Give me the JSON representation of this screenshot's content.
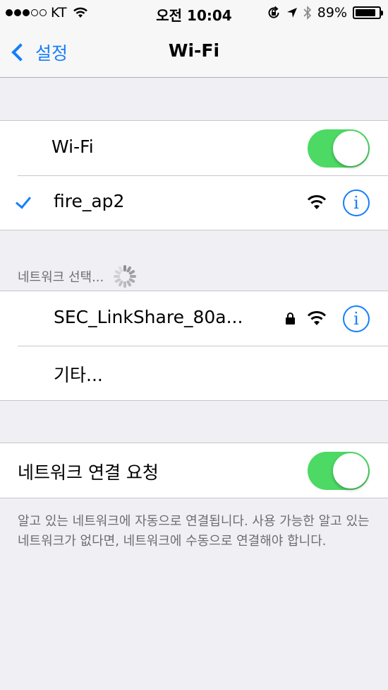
{
  "status_bar": {
    "carrier": "KT",
    "time": "오전 10:04",
    "battery": "89%",
    "battery_level": 0.89,
    "signal_bars": 3,
    "signal_total": 5
  },
  "nav": {
    "back_label": "설정",
    "title": "Wi-Fi"
  },
  "wifi_section": {
    "toggle_label": "Wi-Fi",
    "toggle_on": true,
    "connected_network": "fire_ap2"
  },
  "networks_section": {
    "header": "네트워크 선택...",
    "networks": [
      {
        "name": "SEC_LinkShare_80a...",
        "locked": true
      }
    ],
    "other_label": "기타..."
  },
  "ask_section": {
    "label": "네트워크 연결 요청",
    "toggle_on": true,
    "footer": "알고 있는 네트워크에 자동으로 연결됩니다. 사용 가능한 알고 있는 네트워크가 없다면, 네트워크에 수동으로 연결해야 합니다."
  },
  "colors": {
    "accent": "#157efb",
    "toggle_on": "#4cd964",
    "background": "#efeff4"
  }
}
